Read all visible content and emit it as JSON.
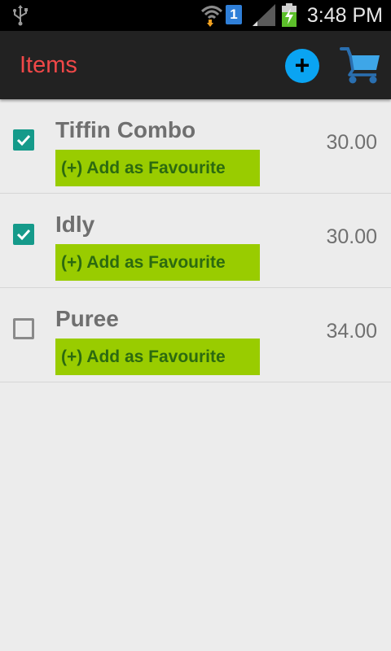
{
  "status_bar": {
    "time": "3:48 PM",
    "sim_slot": "1",
    "icons": [
      "usb-icon",
      "wifi-icon",
      "sim-icon",
      "signal-icon",
      "battery-charging-icon"
    ]
  },
  "action_bar": {
    "title": "Items",
    "add_icon": "+",
    "icons": [
      "add-circle-icon",
      "shopping-cart-icon"
    ]
  },
  "items": [
    {
      "name": "Tiffin Combo",
      "price": "30.00",
      "favourite_label": "(+) Add as Favourite",
      "checked": true
    },
    {
      "name": "Idly",
      "price": "30.00",
      "favourite_label": "(+) Add as Favourite",
      "checked": true
    },
    {
      "name": "Puree",
      "price": "34.00",
      "favourite_label": "(+) Add as Favourite",
      "checked": false
    }
  ],
  "colors": {
    "title": "#f04848",
    "add_button": "#0aa4f2",
    "favourite_button": "#99cc00",
    "favourite_text": "#2c6a10",
    "checkbox_checked": "#159a8a",
    "action_bar": "#222222",
    "background": "#ececec"
  }
}
